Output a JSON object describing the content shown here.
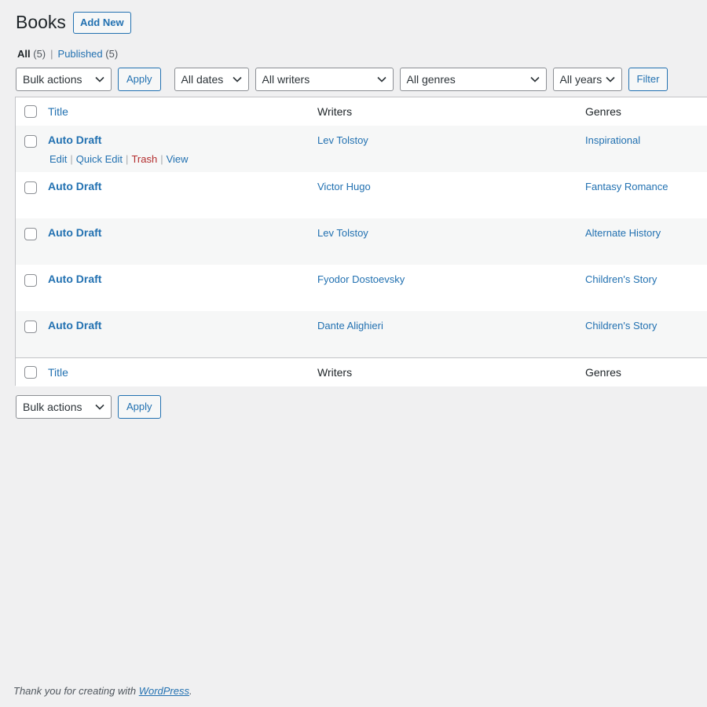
{
  "header": {
    "title": "Books",
    "add_new": "Add New"
  },
  "views": {
    "all_label": "All",
    "all_count": "(5)",
    "separator": "|",
    "published_label": "Published",
    "published_count": "(5)"
  },
  "tablenav_top": {
    "bulk_actions": "Bulk actions",
    "apply": "Apply",
    "dates": "All dates",
    "writers": "All writers",
    "genres": "All genres",
    "years": "All years",
    "filter": "Filter"
  },
  "table": {
    "columns": {
      "title": "Title",
      "writers": "Writers",
      "genres": "Genres"
    },
    "rows": [
      {
        "title": "Auto Draft",
        "writer": "Lev Tolstoy",
        "genre": "Inspirational"
      },
      {
        "title": "Auto Draft",
        "writer": "Victor Hugo",
        "genre": "Fantasy Romance"
      },
      {
        "title": "Auto Draft",
        "writer": "Lev Tolstoy",
        "genre": "Alternate History"
      },
      {
        "title": "Auto Draft",
        "writer": "Fyodor Dostoevsky",
        "genre": "Children's Story"
      },
      {
        "title": "Auto Draft",
        "writer": "Dante Alighieri",
        "genre": "Children's Story"
      }
    ],
    "row_actions": {
      "edit": "Edit",
      "quick_edit": "Quick Edit",
      "trash": "Trash",
      "view": "View",
      "separator": "|"
    }
  },
  "tablenav_bottom": {
    "bulk_actions": "Bulk actions",
    "apply": "Apply"
  },
  "footer": {
    "text": "Thank you for creating with ",
    "link": "WordPress",
    "end": "."
  },
  "colors": {
    "link": "#2271b1",
    "trash": "#b32d2e",
    "background": "#f0f0f1",
    "row_alt": "#f6f7f7"
  },
  "icons": {
    "dropdown": "chevron-down-icon"
  }
}
